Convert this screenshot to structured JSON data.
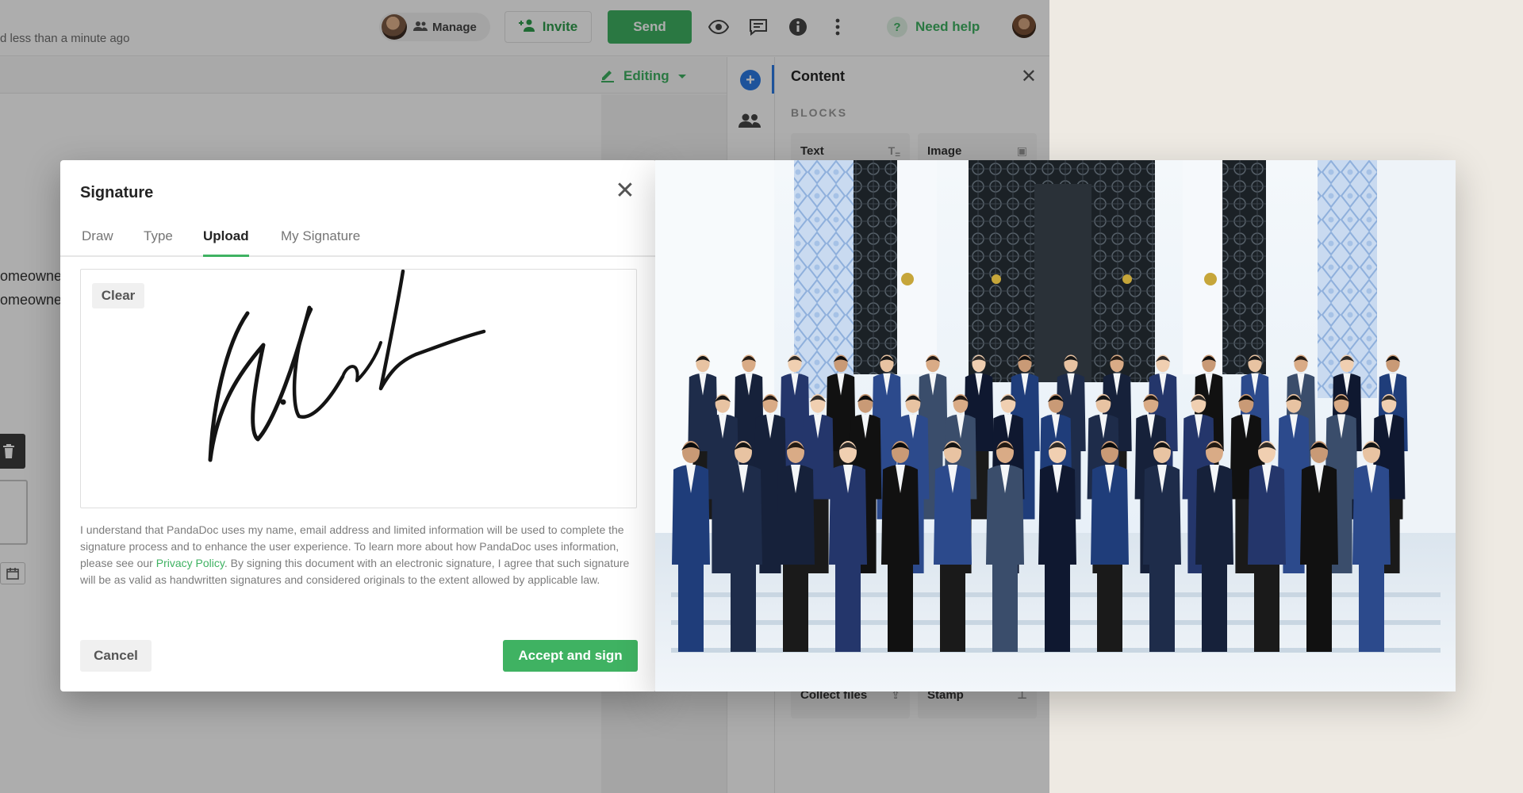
{
  "topbar": {
    "saved_status": "d less than a minute ago",
    "manage_label": "Manage",
    "invite_label": "Invite",
    "send_label": "Send",
    "help_label": "Need help"
  },
  "subbar": {
    "editing_label": "Editing"
  },
  "document": {
    "line1": "omeowne",
    "line2": "omeowner"
  },
  "panel": {
    "title": "Content",
    "section_label": "BLOCKS",
    "blocks": [
      "Text",
      "Image",
      "Collect files",
      "Stamp"
    ]
  },
  "signature_modal": {
    "title": "Signature",
    "tabs": [
      "Draw",
      "Type",
      "Upload",
      "My Signature"
    ],
    "active_tab": "Upload",
    "clear_label": "Clear",
    "disclaimer_before": "I understand that PandaDoc uses my name, email address and limited information will be used to complete the signature process and to enhance the user experience. To learn more about how PandaDoc uses information, please see our ",
    "privacy_link": "Privacy Policy",
    "disclaimer_after": ". By signing this document with an electronic signature, I agree that such signature will be as valid as handwritten signatures and considered originals to the extent allowed by applicable law.",
    "cancel_label": "Cancel",
    "accept_label": "Accept and sign"
  },
  "colors": {
    "accent_green": "#3fb262",
    "blue_accent": "#2c7be5",
    "page_background": "#eeeae3"
  },
  "icons": {
    "manage": "people-icon",
    "invite": "person-plus-icon",
    "preview": "eye-icon",
    "comments": "chat-icon",
    "info": "info-icon",
    "more": "kebab-icon",
    "help": "question-icon",
    "editing": "pencil-icon",
    "add": "plus-circle-icon",
    "recipients": "people-icon",
    "close": "close-icon",
    "text_block": "text-icon",
    "image_block": "image-icon",
    "trash": "trash-icon",
    "calendar": "calendar-icon"
  }
}
